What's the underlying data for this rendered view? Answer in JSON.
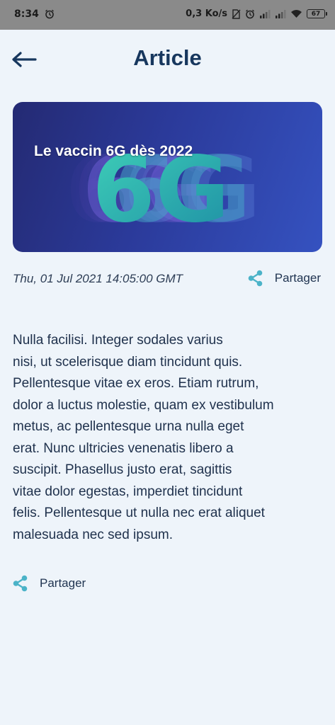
{
  "status_bar": {
    "time": "8:34",
    "network_speed": "0,3 Ko/s",
    "battery_level": "67",
    "icons": [
      "alarm-icon",
      "no-sim-icon",
      "signal-icon",
      "wifi-icon",
      "battery-icon"
    ]
  },
  "header": {
    "title": "Article",
    "back_icon": "arrow-left-icon"
  },
  "article": {
    "image_headline": "Le vaccin 6G dès 2022",
    "image_graphic_text": "6G",
    "date": "Thu, 01 Jul 2021 14:05:00 GMT",
    "share_label_top": "Partager",
    "body_lines": [
      "Nulla facilisi. Integer sodales varius",
      "nisi, ut scelerisque diam tincidunt quis.",
      "Pellentesque vitae ex eros. Etiam rutrum,",
      "dolor a luctus molestie, quam ex vestibulum",
      "metus, ac pellentesque urna nulla eget",
      "erat. Nunc ultricies venenatis libero a",
      "suscipit. Phasellus justo erat, sagittis",
      "vitae dolor egestas, imperdiet tincidunt",
      "felis. Pellentesque ut nulla nec erat aliquet",
      "malesuada nec sed ipsum."
    ],
    "share_label_bottom": "Partager"
  },
  "colors": {
    "background": "#eef4fa",
    "title": "#17375e",
    "accent_share": "#4bb3c8",
    "hero_gradient_start": "#242a73",
    "hero_gradient_end": "#3552c0",
    "graphic_teal": "#2bb3a6"
  }
}
